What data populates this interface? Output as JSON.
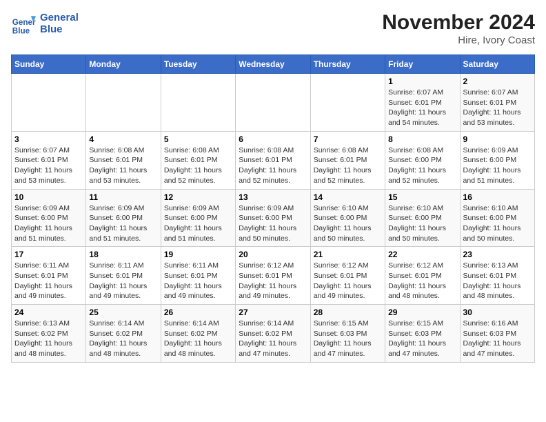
{
  "logo": {
    "line1": "General",
    "line2": "Blue"
  },
  "title": "November 2024",
  "subtitle": "Hire, Ivory Coast",
  "weekdays": [
    "Sunday",
    "Monday",
    "Tuesday",
    "Wednesday",
    "Thursday",
    "Friday",
    "Saturday"
  ],
  "weeks": [
    [
      {
        "day": "",
        "info": ""
      },
      {
        "day": "",
        "info": ""
      },
      {
        "day": "",
        "info": ""
      },
      {
        "day": "",
        "info": ""
      },
      {
        "day": "",
        "info": ""
      },
      {
        "day": "1",
        "info": "Sunrise: 6:07 AM\nSunset: 6:01 PM\nDaylight: 11 hours and 54 minutes."
      },
      {
        "day": "2",
        "info": "Sunrise: 6:07 AM\nSunset: 6:01 PM\nDaylight: 11 hours and 53 minutes."
      }
    ],
    [
      {
        "day": "3",
        "info": "Sunrise: 6:07 AM\nSunset: 6:01 PM\nDaylight: 11 hours and 53 minutes."
      },
      {
        "day": "4",
        "info": "Sunrise: 6:08 AM\nSunset: 6:01 PM\nDaylight: 11 hours and 53 minutes."
      },
      {
        "day": "5",
        "info": "Sunrise: 6:08 AM\nSunset: 6:01 PM\nDaylight: 11 hours and 52 minutes."
      },
      {
        "day": "6",
        "info": "Sunrise: 6:08 AM\nSunset: 6:01 PM\nDaylight: 11 hours and 52 minutes."
      },
      {
        "day": "7",
        "info": "Sunrise: 6:08 AM\nSunset: 6:01 PM\nDaylight: 11 hours and 52 minutes."
      },
      {
        "day": "8",
        "info": "Sunrise: 6:08 AM\nSunset: 6:00 PM\nDaylight: 11 hours and 52 minutes."
      },
      {
        "day": "9",
        "info": "Sunrise: 6:09 AM\nSunset: 6:00 PM\nDaylight: 11 hours and 51 minutes."
      }
    ],
    [
      {
        "day": "10",
        "info": "Sunrise: 6:09 AM\nSunset: 6:00 PM\nDaylight: 11 hours and 51 minutes."
      },
      {
        "day": "11",
        "info": "Sunrise: 6:09 AM\nSunset: 6:00 PM\nDaylight: 11 hours and 51 minutes."
      },
      {
        "day": "12",
        "info": "Sunrise: 6:09 AM\nSunset: 6:00 PM\nDaylight: 11 hours and 51 minutes."
      },
      {
        "day": "13",
        "info": "Sunrise: 6:09 AM\nSunset: 6:00 PM\nDaylight: 11 hours and 50 minutes."
      },
      {
        "day": "14",
        "info": "Sunrise: 6:10 AM\nSunset: 6:00 PM\nDaylight: 11 hours and 50 minutes."
      },
      {
        "day": "15",
        "info": "Sunrise: 6:10 AM\nSunset: 6:00 PM\nDaylight: 11 hours and 50 minutes."
      },
      {
        "day": "16",
        "info": "Sunrise: 6:10 AM\nSunset: 6:00 PM\nDaylight: 11 hours and 50 minutes."
      }
    ],
    [
      {
        "day": "17",
        "info": "Sunrise: 6:11 AM\nSunset: 6:01 PM\nDaylight: 11 hours and 49 minutes."
      },
      {
        "day": "18",
        "info": "Sunrise: 6:11 AM\nSunset: 6:01 PM\nDaylight: 11 hours and 49 minutes."
      },
      {
        "day": "19",
        "info": "Sunrise: 6:11 AM\nSunset: 6:01 PM\nDaylight: 11 hours and 49 minutes."
      },
      {
        "day": "20",
        "info": "Sunrise: 6:12 AM\nSunset: 6:01 PM\nDaylight: 11 hours and 49 minutes."
      },
      {
        "day": "21",
        "info": "Sunrise: 6:12 AM\nSunset: 6:01 PM\nDaylight: 11 hours and 49 minutes."
      },
      {
        "day": "22",
        "info": "Sunrise: 6:12 AM\nSunset: 6:01 PM\nDaylight: 11 hours and 48 minutes."
      },
      {
        "day": "23",
        "info": "Sunrise: 6:13 AM\nSunset: 6:01 PM\nDaylight: 11 hours and 48 minutes."
      }
    ],
    [
      {
        "day": "24",
        "info": "Sunrise: 6:13 AM\nSunset: 6:02 PM\nDaylight: 11 hours and 48 minutes."
      },
      {
        "day": "25",
        "info": "Sunrise: 6:14 AM\nSunset: 6:02 PM\nDaylight: 11 hours and 48 minutes."
      },
      {
        "day": "26",
        "info": "Sunrise: 6:14 AM\nSunset: 6:02 PM\nDaylight: 11 hours and 48 minutes."
      },
      {
        "day": "27",
        "info": "Sunrise: 6:14 AM\nSunset: 6:02 PM\nDaylight: 11 hours and 47 minutes."
      },
      {
        "day": "28",
        "info": "Sunrise: 6:15 AM\nSunset: 6:03 PM\nDaylight: 11 hours and 47 minutes."
      },
      {
        "day": "29",
        "info": "Sunrise: 6:15 AM\nSunset: 6:03 PM\nDaylight: 11 hours and 47 minutes."
      },
      {
        "day": "30",
        "info": "Sunrise: 6:16 AM\nSunset: 6:03 PM\nDaylight: 11 hours and 47 minutes."
      }
    ]
  ]
}
